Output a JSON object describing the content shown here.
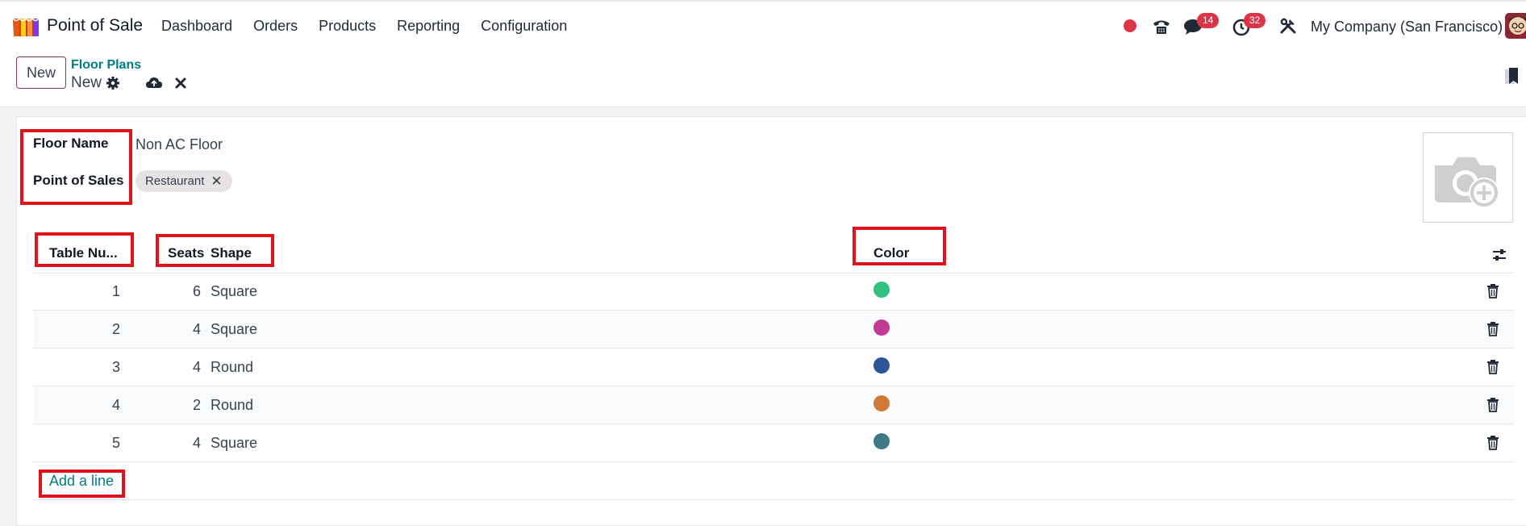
{
  "topbar": {
    "app_title": "Point of Sale",
    "menu": [
      "Dashboard",
      "Orders",
      "Products",
      "Reporting",
      "Configuration"
    ],
    "messages_badge": "14",
    "activities_badge": "32",
    "company": "My Company (San Francisco)"
  },
  "controlbar": {
    "new_button": "New",
    "breadcrumb_parent": "Floor Plans",
    "breadcrumb_current": "New"
  },
  "form": {
    "floor_name_label": "Floor Name",
    "floor_name_value": "Non AC Floor",
    "pos_label": "Point of Sales",
    "pos_tag": "Restaurant",
    "tag_remove": "✕"
  },
  "table": {
    "headers": {
      "table_number": "Table Nu...",
      "seats": "Seats",
      "shape": "Shape",
      "color": "Color"
    },
    "rows": [
      {
        "number": "1",
        "seats": "6",
        "shape": "Square",
        "color": "#2ec27e"
      },
      {
        "number": "2",
        "seats": "4",
        "shape": "Square",
        "color": "#c03a93"
      },
      {
        "number": "3",
        "seats": "4",
        "shape": "Round",
        "color": "#2c5597"
      },
      {
        "number": "4",
        "seats": "2",
        "shape": "Round",
        "color": "#d07a3a"
      },
      {
        "number": "5",
        "seats": "4",
        "shape": "Square",
        "color": "#3e7a86"
      }
    ],
    "add_line": "Add a line"
  },
  "colors": {
    "accent": "#017e84",
    "primary_brand": "#8b3a4a",
    "annotation_red": "#e0121b",
    "badge_red": "#dc3545"
  },
  "icons": {
    "recording": "red-dot",
    "phone": "phone-icon",
    "messages": "chat-icon",
    "activities": "clock-icon",
    "tools": "tools-icon",
    "settings": "gear-icon",
    "save": "cloud-upload-icon",
    "discard": "close-icon",
    "bookmark": "bookmark-icon",
    "photo": "camera-plus-icon",
    "optional_columns": "sliders-icon",
    "delete": "trash-icon"
  }
}
